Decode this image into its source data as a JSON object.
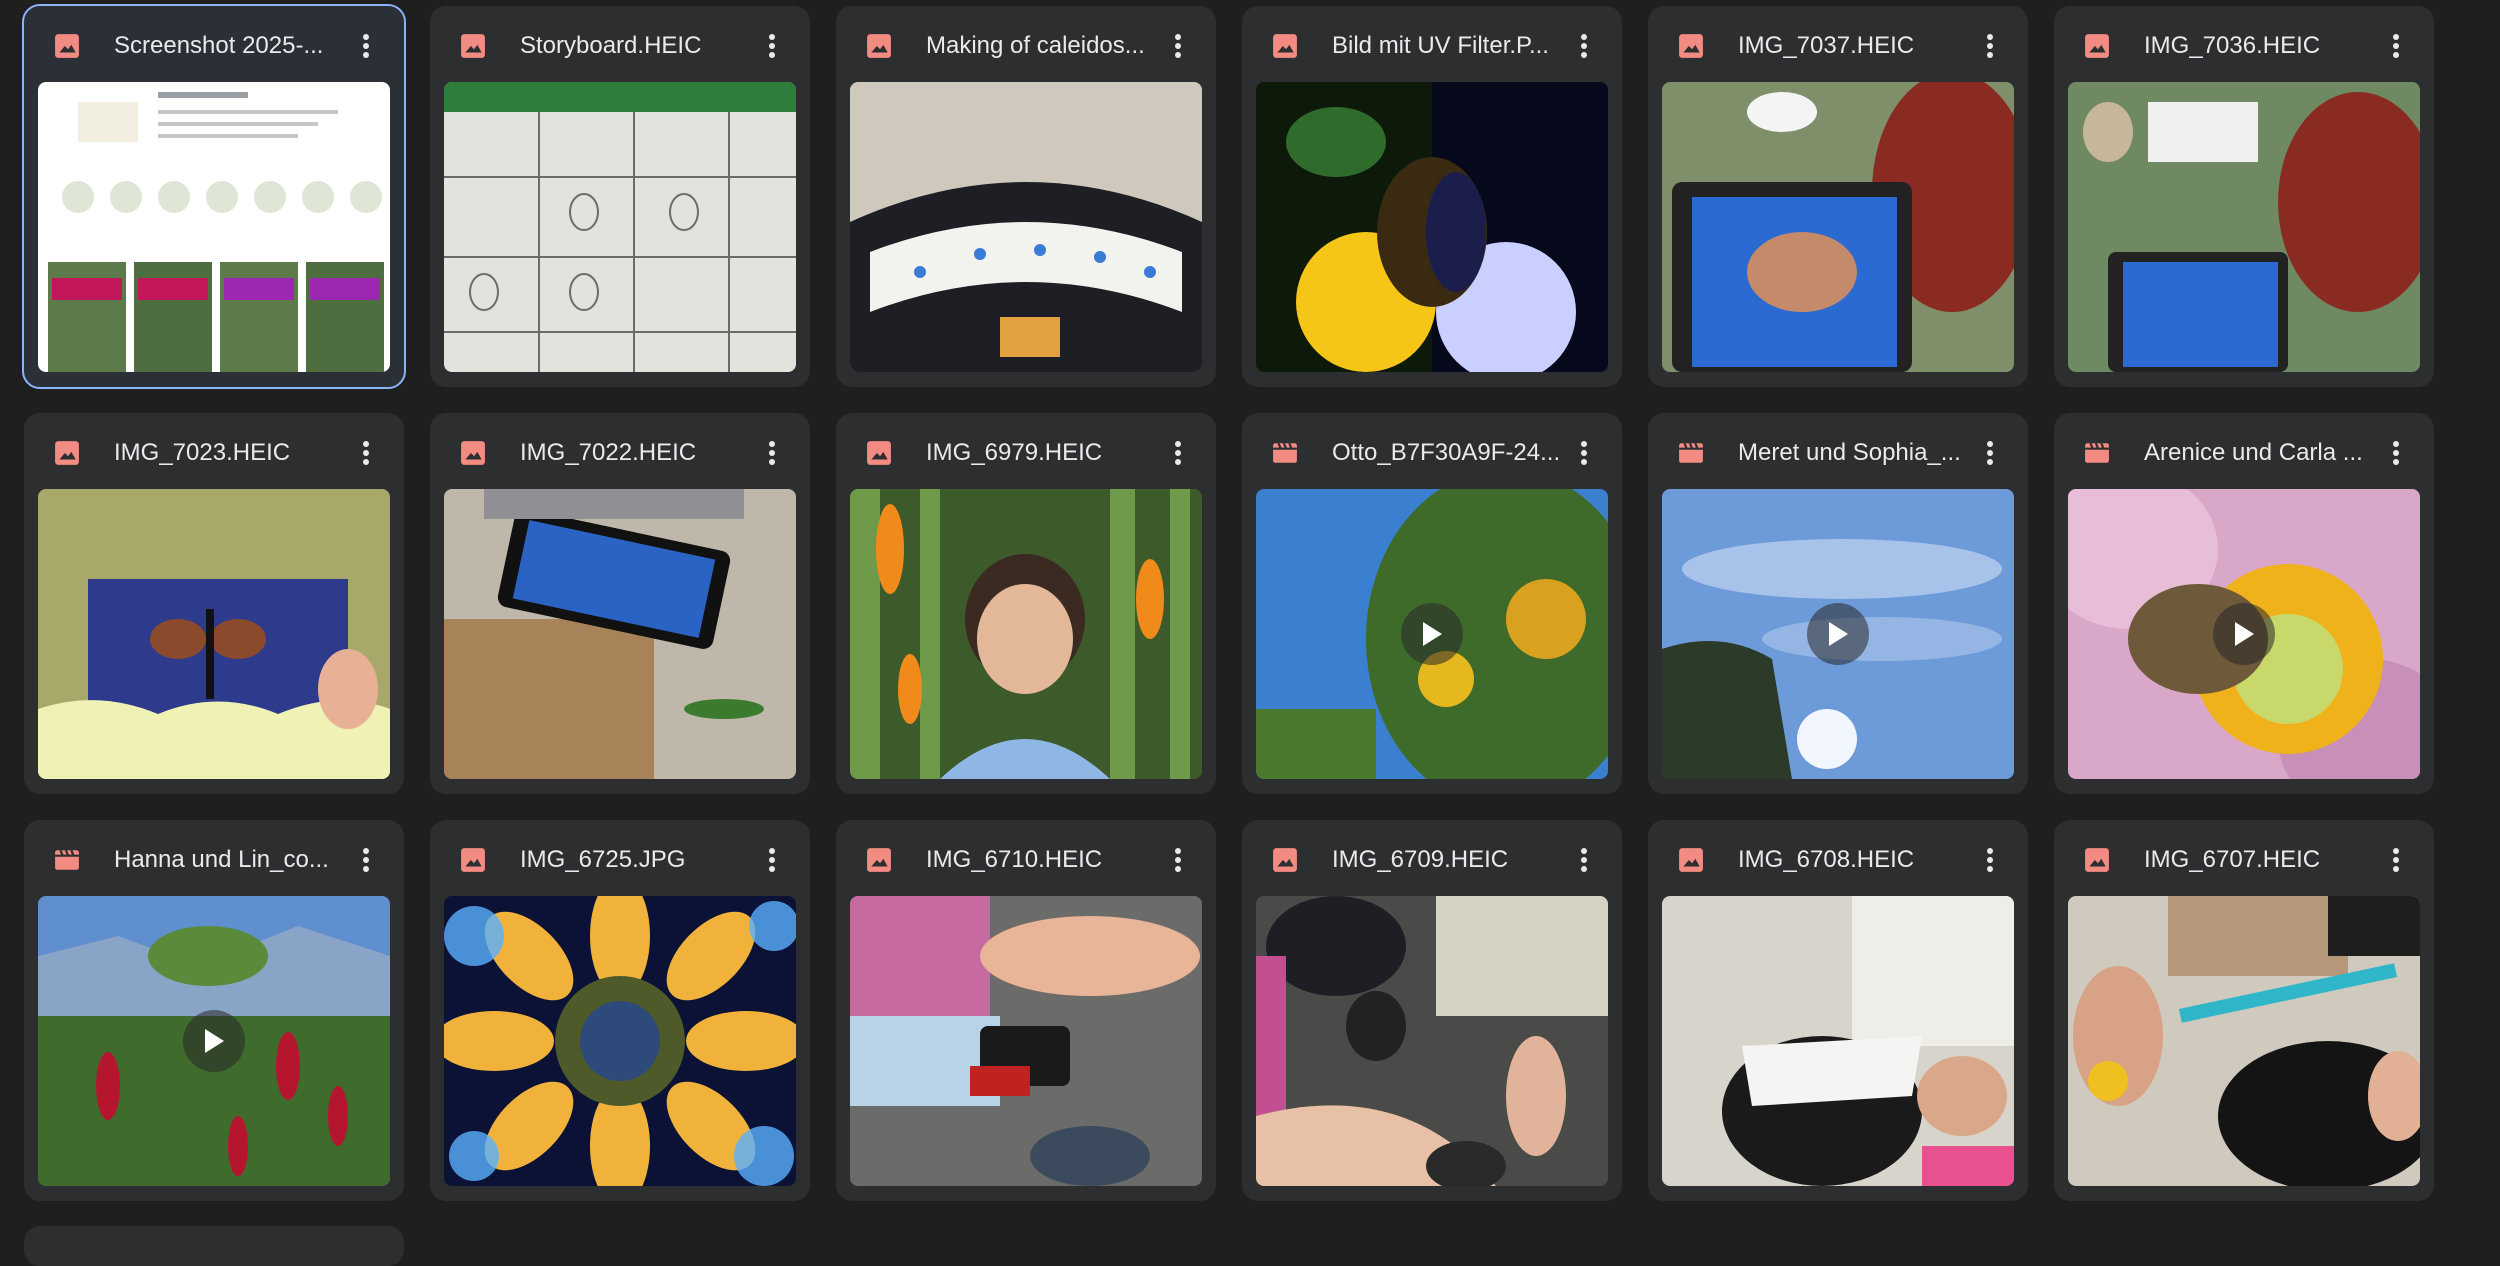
{
  "colors": {
    "background": "#1f1f1f",
    "card": "#2d2e30",
    "selected_outline": "#8ab4f8",
    "image_icon": "#f28b82",
    "video_icon": "#f28b82",
    "title_text": "#e8eaed"
  },
  "files": [
    {
      "name": "Screenshot 2025-...",
      "type": "image",
      "selected": true
    },
    {
      "name": "Storyboard.HEIC",
      "type": "image"
    },
    {
      "name": "Making of caleidos...",
      "type": "image"
    },
    {
      "name": "Bild mit UV Filter.P...",
      "type": "image"
    },
    {
      "name": "IMG_7037.HEIC",
      "type": "image"
    },
    {
      "name": "IMG_7036.HEIC",
      "type": "image"
    },
    {
      "name": "IMG_7023.HEIC",
      "type": "image"
    },
    {
      "name": "IMG_7022.HEIC",
      "type": "image"
    },
    {
      "name": "IMG_6979.HEIC",
      "type": "image"
    },
    {
      "name": "Otto_B7F30A9F-24...",
      "type": "video"
    },
    {
      "name": "Meret und Sophia_...",
      "type": "video"
    },
    {
      "name": "Arenice und Carla ...",
      "type": "video"
    },
    {
      "name": "Hanna und Lin_co...",
      "type": "video"
    },
    {
      "name": "IMG_6725.JPG",
      "type": "image"
    },
    {
      "name": "IMG_6710.HEIC",
      "type": "image"
    },
    {
      "name": "IMG_6709.HEIC",
      "type": "image"
    },
    {
      "name": "IMG_6708.HEIC",
      "type": "image"
    },
    {
      "name": "IMG_6707.HEIC",
      "type": "image"
    }
  ],
  "icons": {
    "image": "image-file-icon",
    "video": "video-file-icon",
    "more": "more-vert-icon",
    "play": "play-icon"
  }
}
